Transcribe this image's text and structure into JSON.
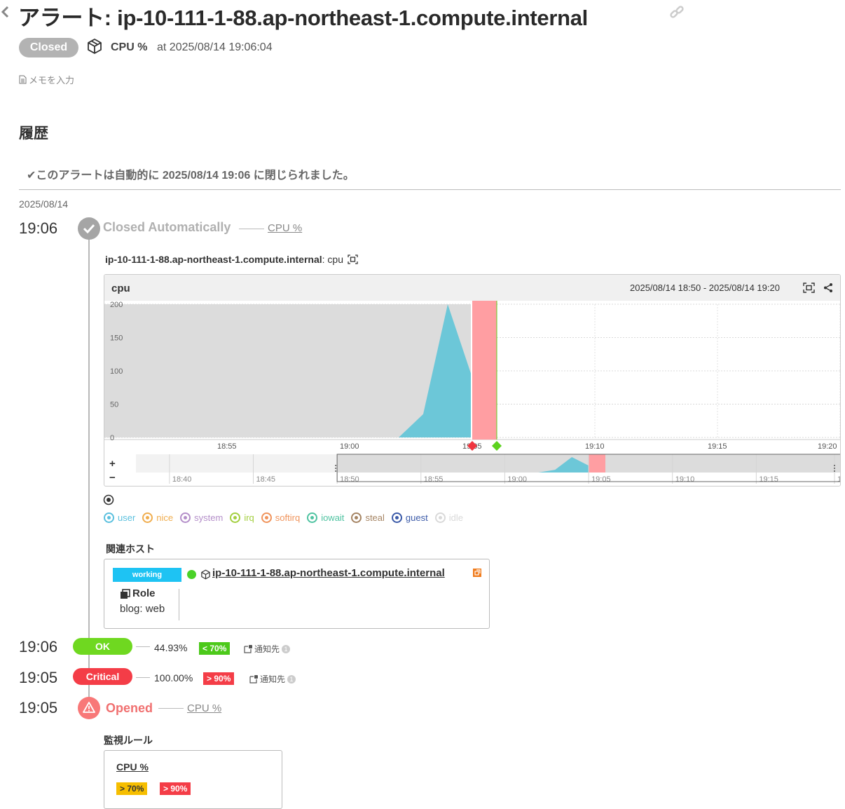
{
  "header": {
    "title": "アラート: ip-10-111-1-88.ap-northeast-1.compute.internal",
    "status": "Closed",
    "metric": "CPU %",
    "at": "at 2025/08/14 19:06:04",
    "memo_placeholder": "メモを入力"
  },
  "history": {
    "heading": "履歴",
    "closed_message": "✔このアラートは自動的に 2025/08/14 19:06 に閉じられました。",
    "date": "2025/08/14",
    "closed_event": {
      "time": "19:06",
      "label": "Closed Automatically",
      "monitor_link": "CPU %"
    },
    "graph": {
      "caption_host": "ip-10-111-1-88.ap-northeast-1.compute.internal",
      "caption_metric": ": cpu",
      "title": "cpu",
      "range": "2025/08/14 18:50 - 2025/08/14 19:20",
      "zoom_in": "+",
      "zoom_out": "−",
      "legend": [
        {
          "name": "user",
          "color": "#5bc0de"
        },
        {
          "name": "nice",
          "color": "#f0ad4e"
        },
        {
          "name": "system",
          "color": "#b48fc9"
        },
        {
          "name": "irq",
          "color": "#a3cf3f"
        },
        {
          "name": "softirq",
          "color": "#f0945c"
        },
        {
          "name": "iowait",
          "color": "#4fc3a1"
        },
        {
          "name": "steal",
          "color": "#a58463"
        },
        {
          "name": "guest",
          "color": "#3b5aa8"
        },
        {
          "name": "idle",
          "color": "#d9d9d9"
        }
      ]
    },
    "chart_data": {
      "type": "area",
      "title": "cpu",
      "x_ticks": [
        "18:55",
        "19:00",
        "19:05",
        "19:10",
        "19:15",
        "19:20"
      ],
      "xlim": [
        "18:50",
        "19:20"
      ],
      "y_ticks": [
        "0",
        "50",
        "100",
        "150",
        "200"
      ],
      "ylim": [
        0,
        200
      ],
      "series": [
        {
          "name": "user",
          "color": "#6cc7d8",
          "x": [
            "19:02",
            "19:03",
            "19:04",
            "19:05"
          ],
          "values": [
            0,
            35,
            200,
            90
          ]
        },
        {
          "name": "idle",
          "color": "#dcdcdc",
          "x": [
            "18:50",
            "19:05"
          ],
          "values": [
            200,
            200
          ]
        }
      ],
      "alert_window": {
        "start": "19:05",
        "end": "19:06",
        "color": "#ff9ea2"
      },
      "markers": [
        {
          "time": "19:05",
          "color": "#f0353f",
          "kind": "critical"
        },
        {
          "time": "19:06",
          "color": "#5cd21e",
          "kind": "ok"
        }
      ],
      "navigator": {
        "ticks": [
          "18:40",
          "18:45",
          "18:50",
          "18:55",
          "19:00",
          "19:05",
          "19:10",
          "19:15",
          "19"
        ],
        "xlim": [
          "18:38",
          "19:20"
        ],
        "selection": [
          "18:50",
          "19:20"
        ]
      }
    },
    "related": {
      "heading": "関連ホスト",
      "status": "working",
      "host": "ip-10-111-1-88.ap-northeast-1.compute.internal",
      "role_label": "Role",
      "role_value": "blog: web"
    },
    "events": [
      {
        "time": "19:06",
        "state": "OK",
        "value": "44.93%",
        "threshold": "< 70%",
        "notify": "通知先",
        "count": "1",
        "pill_color": "#6fd820",
        "thr_color": "#4cc91a"
      },
      {
        "time": "19:05",
        "state": "Critical",
        "value": "100.00%",
        "threshold": "> 90%",
        "notify": "通知先",
        "count": "1",
        "pill_color": "#f43d47",
        "thr_color": "#f43d47"
      }
    ],
    "opened_event": {
      "time": "19:05",
      "label": "Opened",
      "monitor_link": "CPU %"
    },
    "rule": {
      "heading": "監視ルール",
      "name": "CPU %",
      "warning": "> 70%",
      "critical": "> 90%",
      "warning_color": "#f6be00",
      "critical_color": "#f43d47"
    }
  }
}
